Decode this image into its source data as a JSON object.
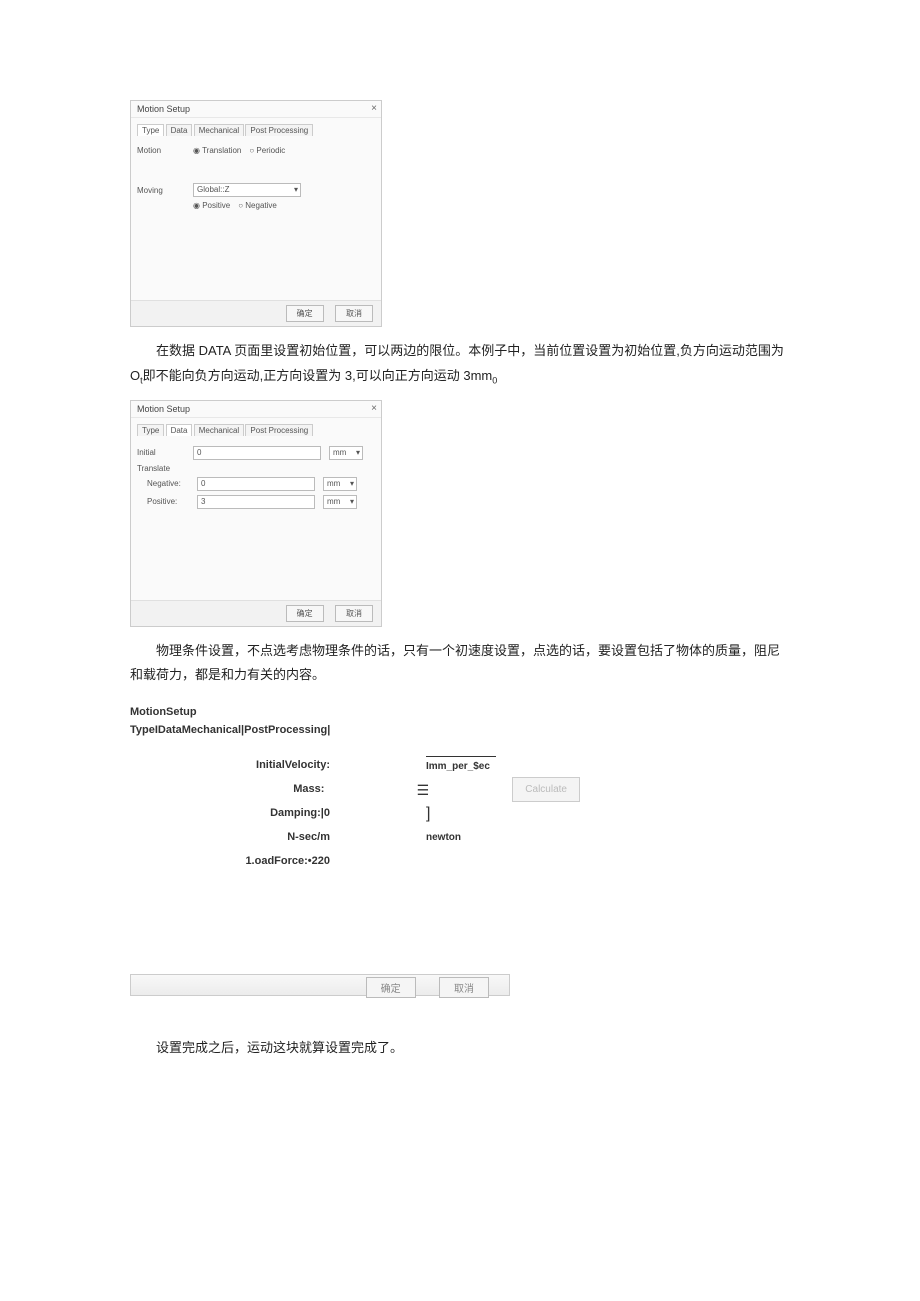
{
  "dialog1": {
    "title": "Motion Setup",
    "tabs": [
      "Type",
      "Data",
      "Mechanical",
      "Post Processing"
    ],
    "active_tab": "Type",
    "labels": {
      "motion": "Motion",
      "moving": "Moving"
    },
    "motion_opts": {
      "translation": "Translation",
      "periodic": "Periodic"
    },
    "moving_value": "Global::Z",
    "sign_opts": {
      "positive": "Positive",
      "negative": "Negative"
    },
    "buttons": {
      "ok": "确定",
      "cancel": "取消"
    }
  },
  "para1_a": "在数据 DATA 页面里设置初始位置，可以两边的限位。本例子中，当前位置设置为初始位置,负方向运动范围为 O",
  "para1_b": "即不能向负方向运动,正方向设置为 3,可以向正方向运动 3mm",
  "para1_sub": "t",
  "para1_sub2": "0",
  "dialog2": {
    "title": "Motion Setup",
    "tabs": [
      "Type",
      "Data",
      "Mechanical",
      "Post Processing"
    ],
    "active_tab": "Data",
    "labels": {
      "initial": "Initial",
      "translate": "Translate",
      "negative": "Negative:",
      "positive": "Positive:"
    },
    "initial_value": "0",
    "initial_unit": "mm",
    "neg_value": "0",
    "neg_unit": "mm",
    "pos_value": "3",
    "pos_unit": "mm",
    "buttons": {
      "ok": "确定",
      "cancel": "取消"
    }
  },
  "para2": "物理条件设置，不点选考虑物理条件的话，只有一个初速度设置，点选的话，要设置包括了物体的质量，阻尼和载荷力，都是和力有关的内容。",
  "mech_heading": "MotionSetup",
  "mech_tabs": "TypeIDataMechanical|PostProcessing|",
  "mech": {
    "iv_label": "InitialVelocity:",
    "iv_unit": "Imm_per_$ec",
    "mass_label": "Mass:",
    "damping_label": "Damping:|0",
    "nsec": "N-sec/m",
    "load_label": "1.oadForce:•220",
    "newton": "newton",
    "calculate": "Calculate"
  },
  "footer_btns": {
    "ok": "确定",
    "cancel": "取消"
  },
  "para3": "设置完成之后，运动这块就算设置完成了。"
}
